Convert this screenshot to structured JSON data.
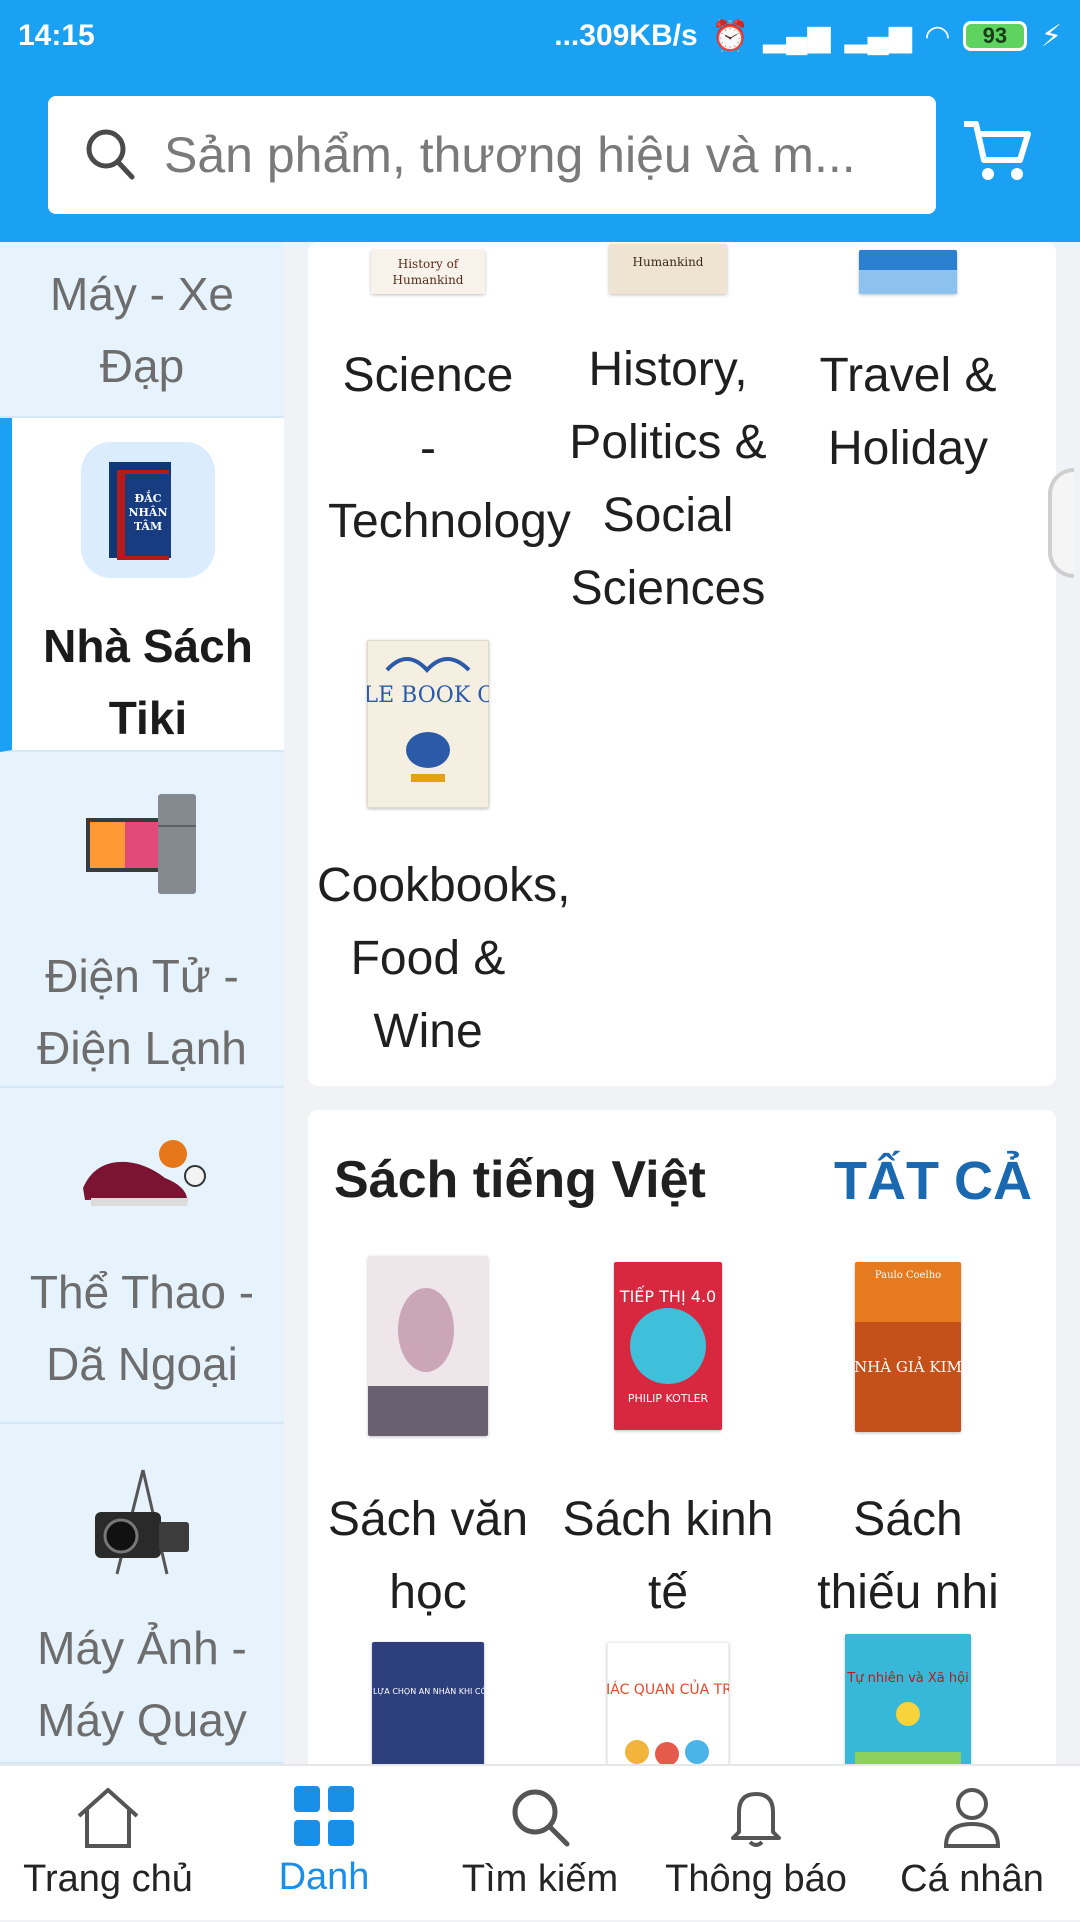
{
  "status_bar": {
    "time": "14:15",
    "network_speed": "...309KB/s",
    "battery": "93"
  },
  "search": {
    "placeholder": "Sản phẩm, thương hiệu và m..."
  },
  "sidebar": {
    "items": [
      {
        "label": "Máy - Xe Đạp",
        "icon": "bicycle-icon"
      },
      {
        "label": "Nhà Sách Tiki",
        "icon": "book-cover-icon",
        "active": true
      },
      {
        "label": "Điện Tử - Điện Lạnh",
        "icon": "tv-fridge-icon"
      },
      {
        "label": "Thể Thao - Dã Ngoại",
        "icon": "sport-shoes-icon"
      },
      {
        "label": "Máy Ảnh - Máy Quay Phim",
        "icon": "camera-icon"
      }
    ]
  },
  "english_books": {
    "items": [
      {
        "label": "Science - Technology"
      },
      {
        "label": "History, Politics & Social Sciences"
      },
      {
        "label": "Travel & Holiday"
      },
      {
        "label": "Cookbooks, Food & Wine",
        "cover_text": "THE LITTLE BOOK OF HYGGE"
      }
    ]
  },
  "vietnamese_books": {
    "title": "Sách tiếng Việt",
    "see_all": "TẤT CẢ",
    "items": [
      {
        "label": "Sách văn học"
      },
      {
        "label": "Sách kinh tế",
        "cover_text": "TIẾP THỊ 4.0"
      },
      {
        "label": "Sách thiếu nhi",
        "cover_text": "NHÀ GIẢ KIM"
      },
      {
        "label": "",
        "cover_text": "ĐỪNG LỰA CHỌN AN NHÀN KHI CÒN TRẺ"
      },
      {
        "label": "",
        "cover_text": "GIÁC QUAN CỦA TRẺ"
      },
      {
        "label": "",
        "cover_text": "Tự nhiên và Xã hội"
      }
    ]
  },
  "bottom_nav": {
    "items": [
      {
        "label": "Trang chủ",
        "icon": "home-icon"
      },
      {
        "label": "Danh",
        "icon": "grid-icon",
        "active": true
      },
      {
        "label": "Tìm kiếm",
        "icon": "search-icon"
      },
      {
        "label": "Thông báo",
        "icon": "bell-icon"
      },
      {
        "label": "Cá nhân",
        "icon": "user-icon"
      }
    ]
  },
  "colors": {
    "primary": "#1aa1f3",
    "link": "#1a68b0",
    "sidebar_bg": "#e6f3fc"
  }
}
